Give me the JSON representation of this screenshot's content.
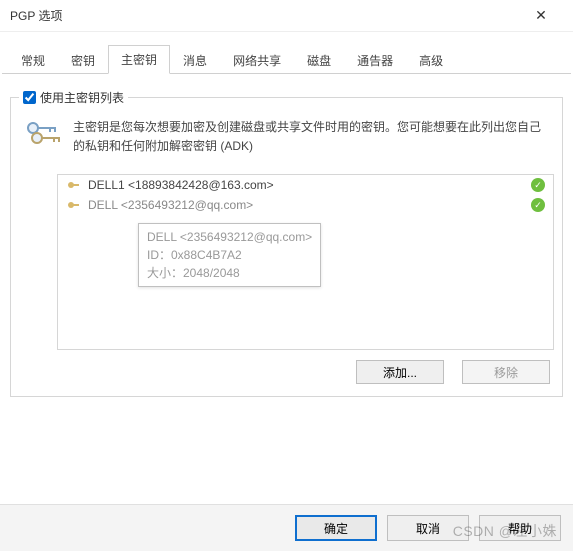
{
  "window": {
    "title": "PGP 选项"
  },
  "tabs": {
    "items": [
      {
        "label": "常规"
      },
      {
        "label": "密钥"
      },
      {
        "label": "主密钥"
      },
      {
        "label": "消息"
      },
      {
        "label": "网络共享"
      },
      {
        "label": "磁盘"
      },
      {
        "label": "通告器"
      },
      {
        "label": "高级"
      }
    ],
    "active_index": 2
  },
  "group": {
    "checkbox_label": "使用主密钥列表",
    "checked": true,
    "description": "主密钥是您每次想要加密及创建磁盘或共享文件时用的密钥。您可能想要在此列出您自己的私钥和任何附加解密密钥 (ADK)"
  },
  "keylist": {
    "rows": [
      {
        "text": "DELL1 <18893842428@163.com>",
        "verified": true,
        "dim": false
      },
      {
        "text": "DELL <2356493212@qq.com>",
        "verified": true,
        "dim": true
      }
    ]
  },
  "tooltip": {
    "line1": "DELL <2356493212@qq.com>",
    "line2": "ID：0x88C4B7A2",
    "line3": "大小：2048/2048"
  },
  "buttons": {
    "add": "添加...",
    "remove": "移除",
    "ok": "确定",
    "cancel": "取消",
    "help": "帮助"
  },
  "watermark": "CSDN @左小姝"
}
